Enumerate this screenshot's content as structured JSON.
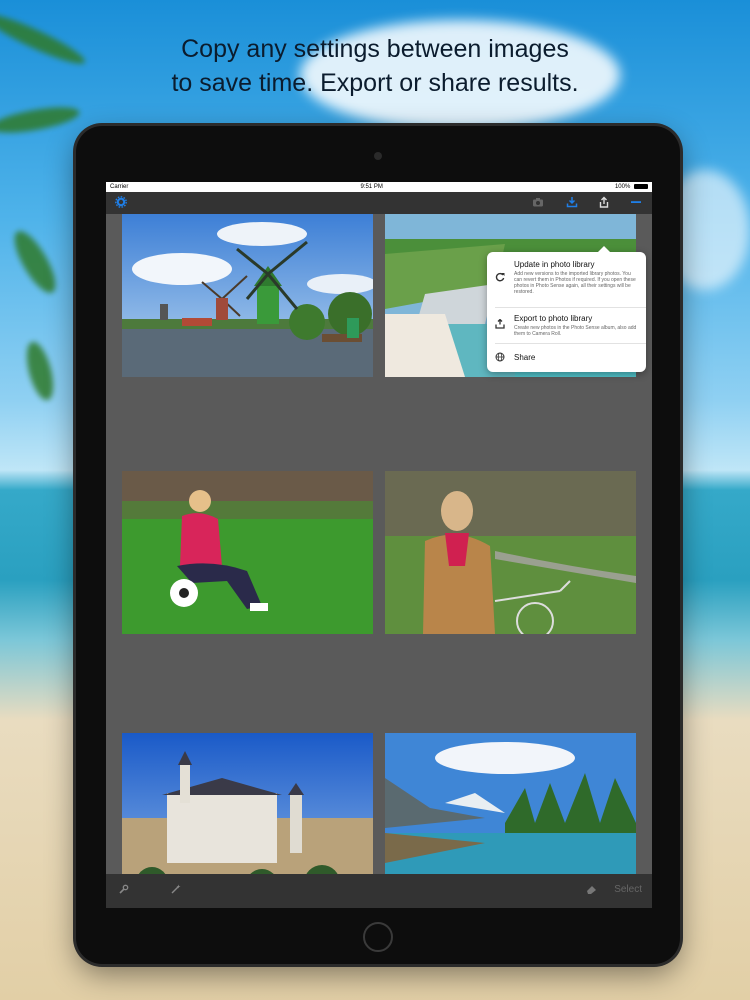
{
  "headline": {
    "line1": "Copy any settings between images",
    "line2": "to save time. Export or share results."
  },
  "statusbar": {
    "carrier": "Carrier",
    "time": "9:51 PM",
    "battery": "100%"
  },
  "toolbar": {
    "settings_icon": "gear-icon",
    "camera_icon": "camera-icon",
    "save_icon": "download-icon",
    "share_icon": "share-icon",
    "menu_icon": "minus-icon"
  },
  "popover": {
    "items": [
      {
        "icon": "refresh-icon",
        "title": "Update in photo library",
        "description": "Add new versions to the imported library photos. You can revert them in Photos if required. If you open these photos in Photo Sense again, all their settings will be restored."
      },
      {
        "icon": "export-icon",
        "title": "Export to photo library",
        "description": "Create new photos in the Photo Sense album, also add them to Camera Roll."
      },
      {
        "icon": "globe-icon",
        "title": "Share",
        "description": ""
      }
    ]
  },
  "grid": {
    "photos": [
      "windmill",
      "coastline",
      "woman-with-ball",
      "woman-with-bicycle",
      "castle",
      "mountain-lake"
    ]
  },
  "bottombar": {
    "select_label": "Select"
  },
  "colors": {
    "accent": "#1f7fe8",
    "toolbar": "#333333",
    "grid_bg": "#5a5a5a"
  }
}
